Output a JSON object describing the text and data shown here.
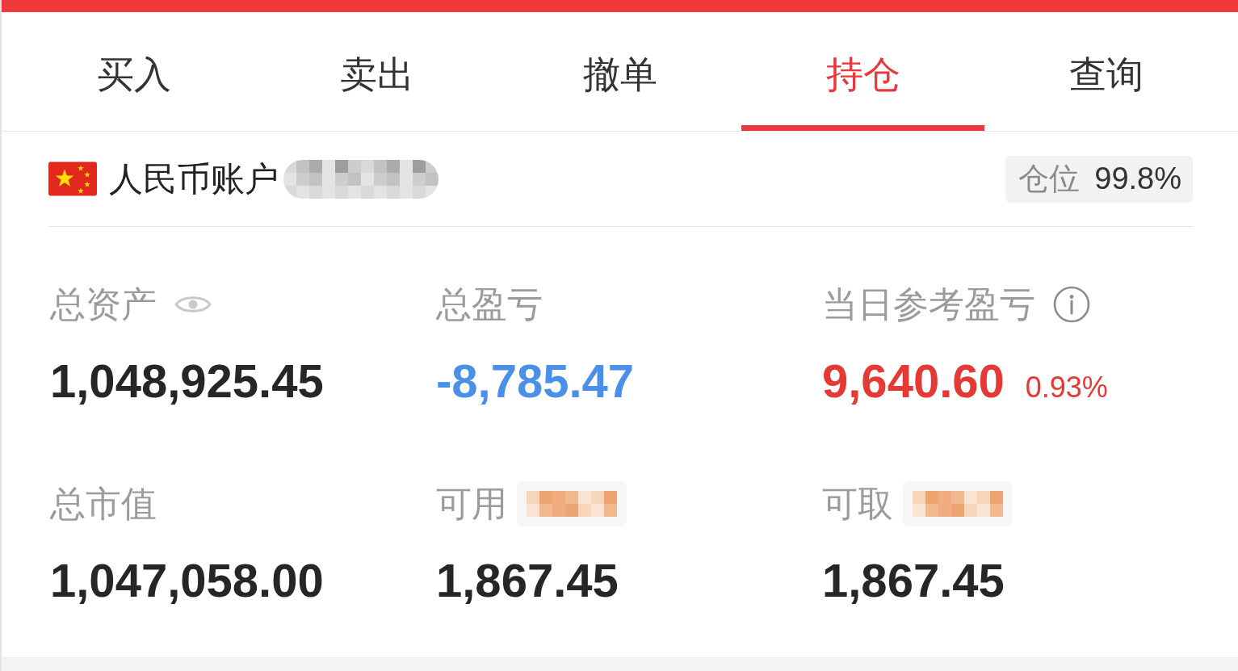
{
  "tabs": [
    {
      "label": "买入",
      "selected": false
    },
    {
      "label": "卖出",
      "selected": false
    },
    {
      "label": "撤单",
      "selected": false
    },
    {
      "label": "持仓",
      "selected": true
    },
    {
      "label": "查询",
      "selected": false
    }
  ],
  "account": {
    "label": "人民币账户",
    "number_redacted": true
  },
  "position": {
    "label": "仓位",
    "value": "99.8%"
  },
  "metrics": [
    {
      "kind": "with-eye",
      "label": "总资产",
      "value": "1,048,925.45",
      "color": "#262626"
    },
    {
      "kind": "plain",
      "label": "总盈亏",
      "value": "-8,785.47",
      "color": "#4a8fe8"
    },
    {
      "kind": "with-info",
      "label": "当日参考盈亏",
      "value": "9,640.60",
      "change": "0.93%",
      "color": "#e53935"
    },
    {
      "kind": "plain",
      "label": "总市值",
      "value": "1,047,058.00",
      "color": "#262626"
    },
    {
      "kind": "with-link",
      "label": "可用",
      "value": "1,867.45",
      "color": "#262626"
    },
    {
      "kind": "with-link",
      "label": "可取",
      "value": "1,867.45",
      "color": "#262626"
    }
  ]
}
